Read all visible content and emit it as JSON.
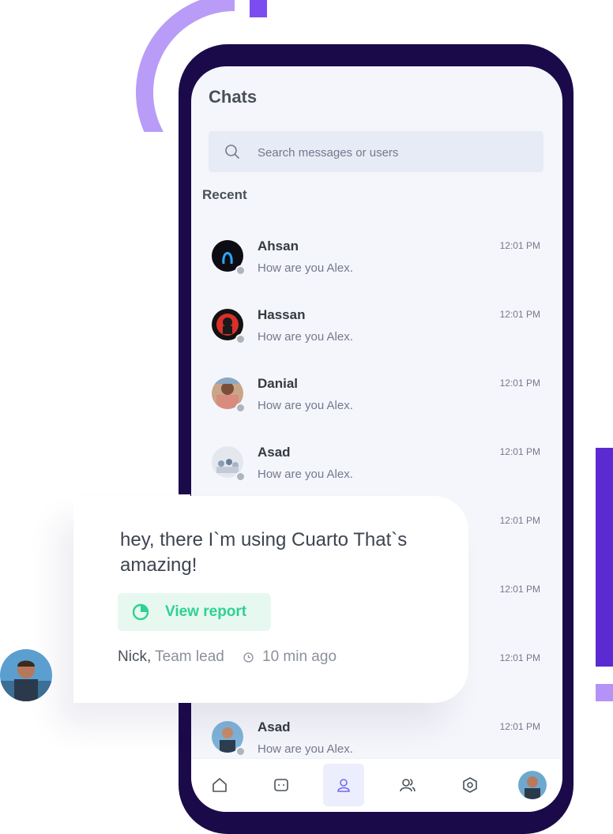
{
  "header": {
    "title": "Chats"
  },
  "search": {
    "placeholder": "Search messages or users"
  },
  "recent": {
    "label": "Recent"
  },
  "chats": [
    {
      "name": "Ahsan",
      "message": "How are you Alex.",
      "time": "12:01 PM"
    },
    {
      "name": "Hassan",
      "message": "How are you Alex.",
      "time": "12:01 PM"
    },
    {
      "name": "Danial",
      "message": "How are you Alex.",
      "time": "12:01 PM"
    },
    {
      "name": "Asad",
      "message": "How are you Alex.",
      "time": "12:01 PM"
    },
    {
      "name": "",
      "message": "",
      "time": "12:01 PM"
    },
    {
      "name": "",
      "message": "",
      "time": "12:01 PM"
    },
    {
      "name": "",
      "message": "",
      "time": "12:01 PM"
    },
    {
      "name": "Asad",
      "message": "How are you Alex.",
      "time": "12:01 PM"
    }
  ],
  "card": {
    "message": "hey, there I`m using Cuarto That`s amazing!",
    "button_label": "View report",
    "author": "Nick,",
    "role": "Team lead",
    "time": "10 min ago"
  },
  "nav": {
    "items": [
      "home-icon",
      "chat-icon",
      "profile-icon",
      "contacts-icon",
      "settings-icon",
      "user-avatar"
    ]
  },
  "colors": {
    "phone_frame": "#1b0a4a",
    "accent_purple": "#7b4df0",
    "accent_green": "#2fd193",
    "screen_bg": "#f5f6fb"
  }
}
